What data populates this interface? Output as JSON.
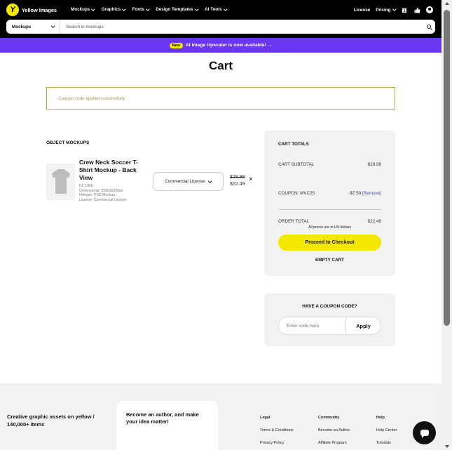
{
  "brand": {
    "name": "Yellow Images",
    "logo_glyph": "Y"
  },
  "nav": {
    "items": [
      "Mockups",
      "Graphics",
      "Fonts",
      "Design Templates",
      "AI Tools"
    ],
    "license": "License",
    "pricing": "Pricing",
    "cart_count": "1"
  },
  "search": {
    "category": "Mockups",
    "placeholder": "Search in mockups"
  },
  "promo": {
    "badge": "New",
    "text": "AI Image Upscaler is now available! →"
  },
  "page": {
    "title": "Cart"
  },
  "notice": "Coupon code applied successfully",
  "cart": {
    "section_label": "OBJECT MOCKUPS",
    "item": {
      "title": "Crew Neck Soccer T-Shirt Mockup - Back View",
      "id": "ID: 1906",
      "dimensional": "Dimensional: 5500x5500px",
      "filetype": "Filetype: PSD Mockup",
      "license": "License: Commercial License",
      "license_select": "Commercial License",
      "old_price": "$29.99",
      "new_price": "$22.49"
    }
  },
  "totals": {
    "heading": "CART TOTALS",
    "subtotal_label": "CART SUBTOTAL",
    "subtotal_value": "$29.99",
    "coupon_label": "COUPON: MVC25",
    "coupon_value": "-$7.50",
    "remove_label": "[Remove]",
    "order_label": "ORDER TOTAL",
    "order_value": "$22.49",
    "note": "All prices are in US dollars",
    "checkout_label": "Proceed to Checkout",
    "empty_label": "EMPTY CART"
  },
  "coupon": {
    "heading": "HAVE A COUPON CODE?",
    "placeholder": "Enter code here",
    "apply": "Apply"
  },
  "footer": {
    "tagline": "Creative graphic assets on yellow / 140,000+ items",
    "author_card": "Become an author, and make your idea matter!",
    "columns": [
      {
        "heading": "Legal",
        "links": [
          "Terms & Conditions",
          "Privacy Policy"
        ]
      },
      {
        "heading": "Community",
        "links": [
          "Become an Author",
          "Affiliate Program"
        ]
      },
      {
        "heading": "Help",
        "links": [
          "Help Center",
          "Tutorials"
        ]
      }
    ]
  },
  "colors": {
    "accent_yellow": "#f5e800",
    "promo_purple": "#6b36f1",
    "link_blue": "#4646d2"
  }
}
